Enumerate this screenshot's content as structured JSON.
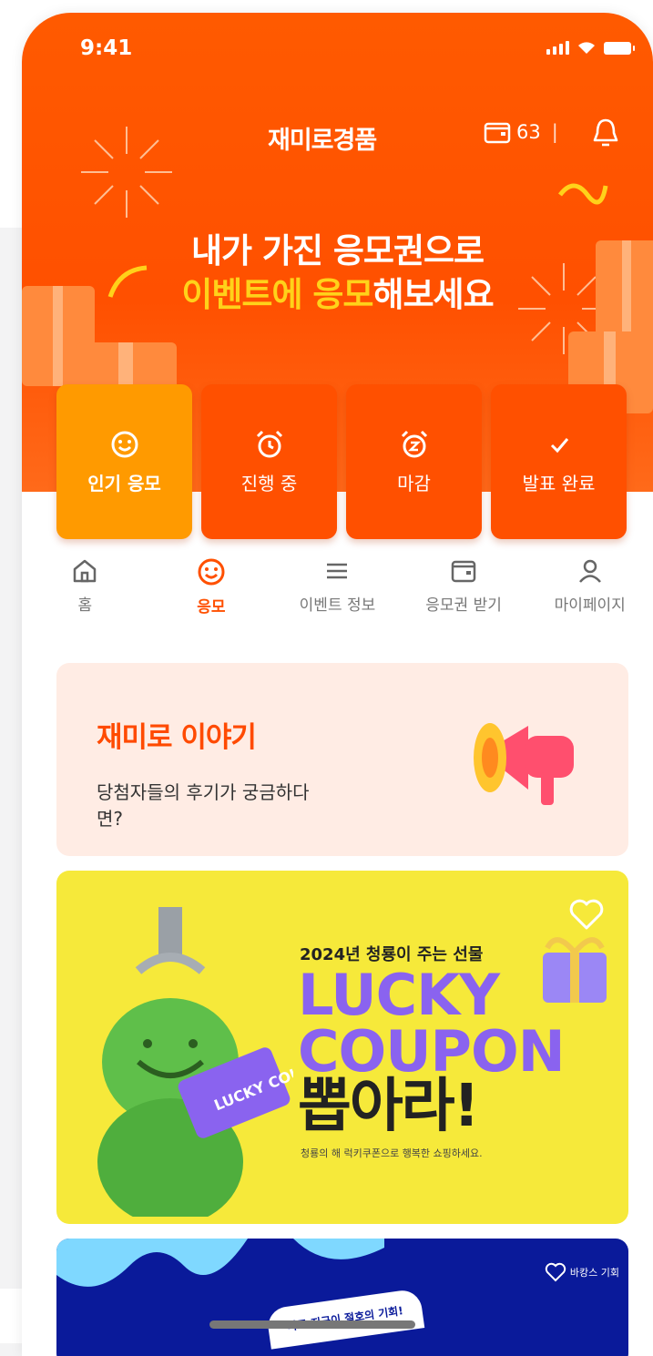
{
  "status": {
    "time": "9:41"
  },
  "header": {
    "title": "재미로경품",
    "ticket_count": "63"
  },
  "hero": {
    "line1": "내가 가진 응모권으로",
    "line2_highlight": "이벤트에 응모",
    "line2_rest": "해보세요"
  },
  "categories": [
    {
      "label": "인기 응모",
      "icon": "smile-icon"
    },
    {
      "label": "진행 중",
      "icon": "alarm-clock-icon"
    },
    {
      "label": "마감",
      "icon": "snooze-clock-icon"
    },
    {
      "label": "발표 완료",
      "icon": "check-icon"
    }
  ],
  "nav": [
    {
      "label": "홈",
      "icon": "home-icon"
    },
    {
      "label": "응모",
      "icon": "smile-icon"
    },
    {
      "label": "이벤트 정보",
      "icon": "menu-icon"
    },
    {
      "label": "응모권 받기",
      "icon": "wallet-icon"
    },
    {
      "label": "마이페이지",
      "icon": "user-icon"
    }
  ],
  "story": {
    "title": "재미로 이야기",
    "desc": "당첨자들의 후기가 궁금하다면?"
  },
  "banner": {
    "subtitle": "2024년 청룡이 주는 선물",
    "lucky": "LUCKY",
    "coupon": "COUPON",
    "ppop": "뽑아라!",
    "desc": "청룡의 해 럭키쿠폰으로 행복한 쇼핑하세요.",
    "coupon_card": "LUCKY COUPON"
  },
  "banner2": {
    "badge": "바로 지금이 절호의 기회!",
    "right_text": "바캉스 기회"
  },
  "colors": {
    "primary": "#ff5000",
    "active_category": "#ff9a00",
    "lucky_purple": "#8a63ef",
    "story_bg": "#ffece4"
  }
}
